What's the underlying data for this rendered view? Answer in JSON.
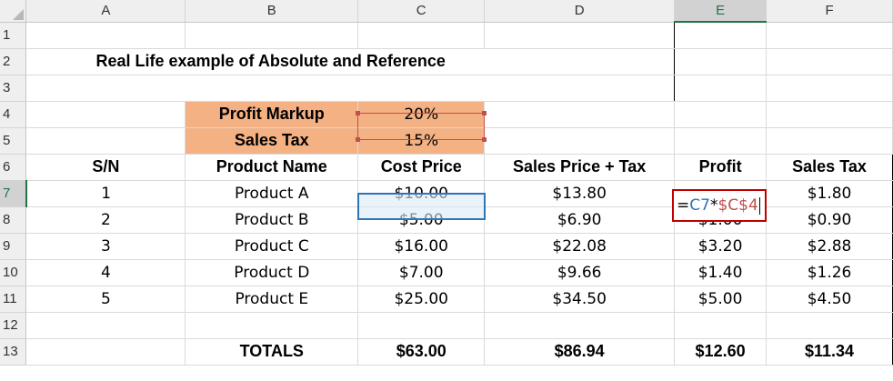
{
  "columns": [
    "A",
    "B",
    "C",
    "D",
    "E",
    "F"
  ],
  "selected_column": "E",
  "selected_row": "7",
  "rows": [
    "1",
    "2",
    "3",
    "4",
    "5",
    "6",
    "7",
    "8",
    "9",
    "10",
    "11",
    "12",
    "13"
  ],
  "title": "Real Life example of Absolute and Reference",
  "params": {
    "markup_label": "Profit Markup",
    "markup_value": "20%",
    "tax_label": "Sales Tax",
    "tax_value": "15%"
  },
  "headers": [
    "S/N",
    "Product Name",
    "Cost Price",
    "Sales Price + Tax",
    "Profit",
    "Sales Tax"
  ],
  "products": [
    {
      "sn": "1",
      "name": "Product A",
      "cost": "$10.00",
      "sales": "$13.80",
      "profit": "",
      "tax": "$1.80"
    },
    {
      "sn": "2",
      "name": "Product B",
      "cost": "$5.00",
      "sales": "$6.90",
      "profit": "$1.00",
      "tax": "$0.90"
    },
    {
      "sn": "3",
      "name": "Product C",
      "cost": "$16.00",
      "sales": "$22.08",
      "profit": "$3.20",
      "tax": "$2.88"
    },
    {
      "sn": "4",
      "name": "Product D",
      "cost": "$7.00",
      "sales": "$9.66",
      "profit": "$1.40",
      "tax": "$1.26"
    },
    {
      "sn": "5",
      "name": "Product E",
      "cost": "$25.00",
      "sales": "$34.50",
      "profit": "$5.00",
      "tax": "$4.50"
    }
  ],
  "editing_formula": {
    "eq": "=",
    "ref1": "C7",
    "op": "*",
    "ref2": "$C$4"
  },
  "totals": {
    "label": "TOTALS",
    "cost": "$63.00",
    "sales": "$86.94",
    "profit": "$12.60",
    "tax": "$11.34"
  },
  "colors": {
    "accent_green": "#217346",
    "param_fill": "#f4b183",
    "active_cell_border": "#2e75b6",
    "edit_cell_border": "#c00000",
    "ref1_color": "#2e75b6",
    "ref2_color": "#c0504d"
  }
}
